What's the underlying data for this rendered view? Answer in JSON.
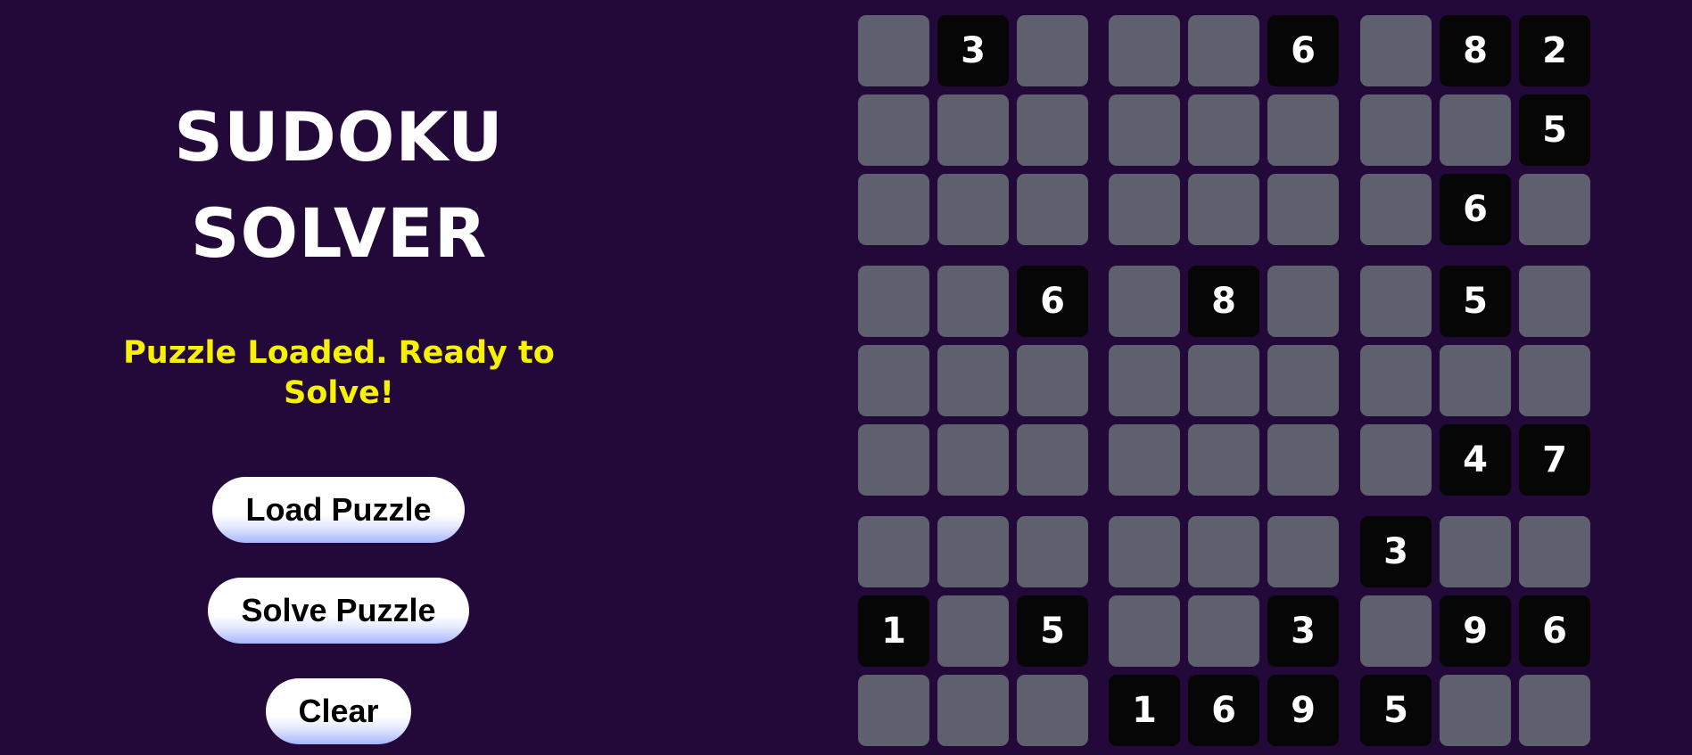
{
  "title": {
    "line1": "SUDOKU",
    "line2": "SOLVER"
  },
  "status": "Puzzle Loaded. Ready to Solve!",
  "buttons": {
    "load": "Load Puzzle",
    "solve": "Solve Puzzle",
    "clear": "Clear"
  },
  "colors": {
    "background": "#23093a",
    "empty_cell": "#5e606e",
    "given_cell": "#060606",
    "status_text": "#f7f200",
    "title_text": "#ffffff"
  },
  "board": [
    [
      "",
      "3",
      "",
      "",
      "",
      "6",
      "",
      "8",
      "2"
    ],
    [
      "",
      "",
      "",
      "",
      "",
      "",
      "",
      "",
      "5"
    ],
    [
      "",
      "",
      "",
      "",
      "",
      "",
      "",
      "6",
      ""
    ],
    [
      "",
      "",
      "6",
      "",
      "8",
      "",
      "",
      "5",
      ""
    ],
    [
      "",
      "",
      "",
      "",
      "",
      "",
      "",
      "",
      ""
    ],
    [
      "",
      "",
      "",
      "",
      "",
      "",
      "",
      "4",
      "7"
    ],
    [
      "",
      "",
      "",
      "",
      "",
      "",
      "3",
      "",
      ""
    ],
    [
      "1",
      "",
      "5",
      "",
      "",
      "3",
      "",
      "9",
      "6"
    ],
    [
      "",
      "",
      "",
      "1",
      "6",
      "9",
      "5",
      "",
      ""
    ]
  ]
}
